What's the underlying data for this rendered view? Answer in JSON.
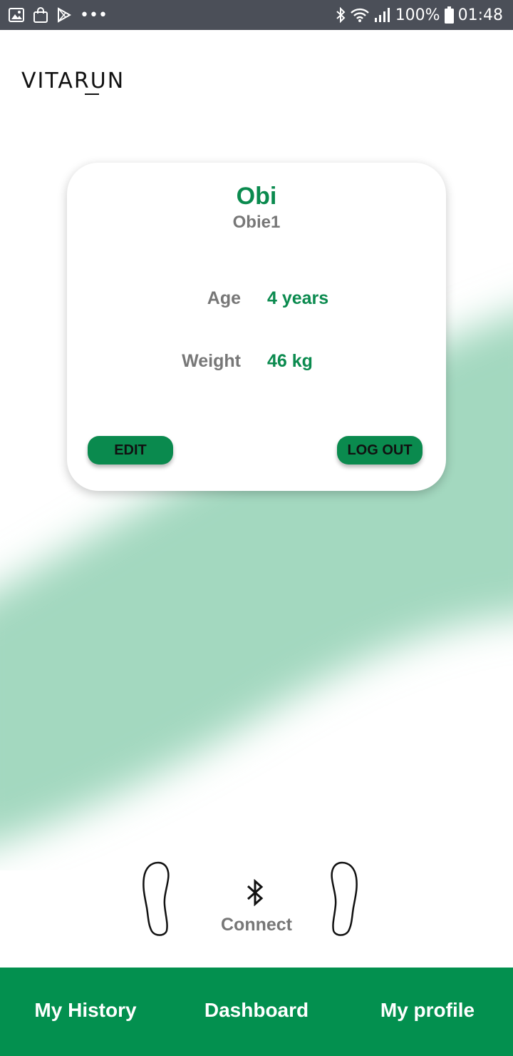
{
  "status_bar": {
    "battery": "100%",
    "time": "01:48",
    "overflow": "•••"
  },
  "app": {
    "logo_text": "VITARUN"
  },
  "profile": {
    "name": "Obi",
    "username": "Obie1",
    "age_label": "Age",
    "age_value": "4 years",
    "weight_label": "Weight",
    "weight_value": "46 kg",
    "edit_label": "EDIT",
    "logout_label": "LOG OUT"
  },
  "connect": {
    "label": "Connect",
    "icon": "bluetooth-icon"
  },
  "bottom_nav": {
    "items": [
      {
        "label": "My History"
      },
      {
        "label": "Dashboard"
      },
      {
        "label": "My profile"
      }
    ]
  },
  "colors": {
    "accent": "#0a8a4e",
    "nav_bg": "#03904f",
    "wave": "#a3d8bf",
    "status_bar": "#4b4f58"
  }
}
